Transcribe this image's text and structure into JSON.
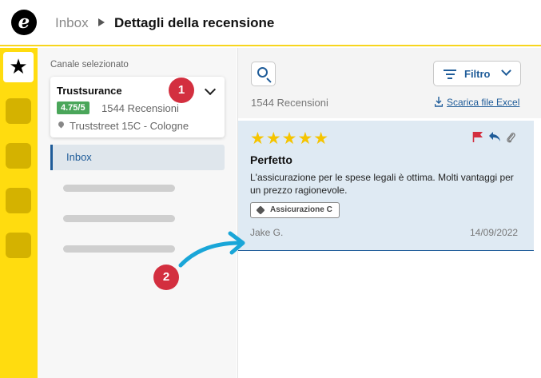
{
  "header": {
    "logo_letter": "e",
    "breadcrumb_root": "Inbox",
    "page_title": "Dettagli della recensione"
  },
  "rail": {
    "active_icon": "star-icon"
  },
  "channels": {
    "label": "Canale selezionato",
    "selected": {
      "name": "Trustsurance",
      "rating": "4.75/5",
      "review_count": "1544 Recensioni",
      "address": "Truststreet 15C - Cologne"
    },
    "nav": [
      {
        "label": "Inbox",
        "active": true
      }
    ]
  },
  "markers": {
    "one": "1",
    "two": "2"
  },
  "toolbar": {
    "filter_label": "Filtro",
    "total_reviews": "1544 Recensioni",
    "download_label": "Scarica file Excel"
  },
  "review": {
    "stars": "★★★★★",
    "title": "Perfetto",
    "body": "L'assicurazione per le spese legali è ottima. Molti vantaggi per un prezzo ragionevole.",
    "tag": "Assicurazione C",
    "author": "Jake G.",
    "date": "14/09/2022"
  },
  "colors": {
    "brand_yellow": "#ffdc0f",
    "accent_blue": "#1f5c99",
    "marker_red": "#d32f3f",
    "star_gold": "#f5c400",
    "rating_green": "#4aa65a",
    "arrow_cyan": "#1aa6d8"
  }
}
